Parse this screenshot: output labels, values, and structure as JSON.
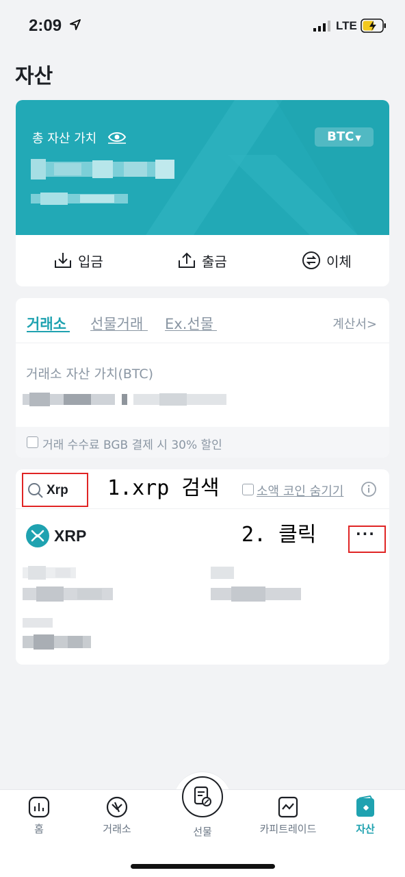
{
  "status_bar": {
    "time": "2:09",
    "network": "LTE"
  },
  "page_title": "자산",
  "asset_summary": {
    "total_label": "총 자산 가치",
    "currency": "BTC",
    "actions": [
      {
        "label": "입금",
        "icon": "deposit-icon"
      },
      {
        "label": "출금",
        "icon": "withdraw-icon"
      },
      {
        "label": "이체",
        "icon": "transfer-icon"
      }
    ]
  },
  "exchange": {
    "tabs": [
      "거래소",
      "선물거래",
      "Ex.선물"
    ],
    "calc_link": "계산서>",
    "value_label": "거래소 자산 가치(BTC)",
    "fee_option": "거래 수수료 BGB 결제 시 30% 할인"
  },
  "coin_list": {
    "search_value": "Xrp",
    "hide_small_label": "소액 코인 숨기기",
    "coins": [
      {
        "symbol": "XRP"
      }
    ],
    "more_label": "···"
  },
  "annotations": {
    "step1": "1.xrp 검색",
    "step2": "2. 클릭"
  },
  "bottom_nav": [
    {
      "label": "홈",
      "icon": "chart-bars-icon"
    },
    {
      "label": "거래소",
      "icon": "exchange-icon"
    },
    {
      "label": "선물",
      "icon": "futures-doc-icon"
    },
    {
      "label": "카피트레이드",
      "icon": "copy-trade-icon"
    },
    {
      "label": "자산",
      "icon": "wallet-icon"
    }
  ],
  "colors": {
    "accent": "#1fa2b0",
    "hero": "#22a9b6",
    "annotation_box": "#e02424"
  }
}
